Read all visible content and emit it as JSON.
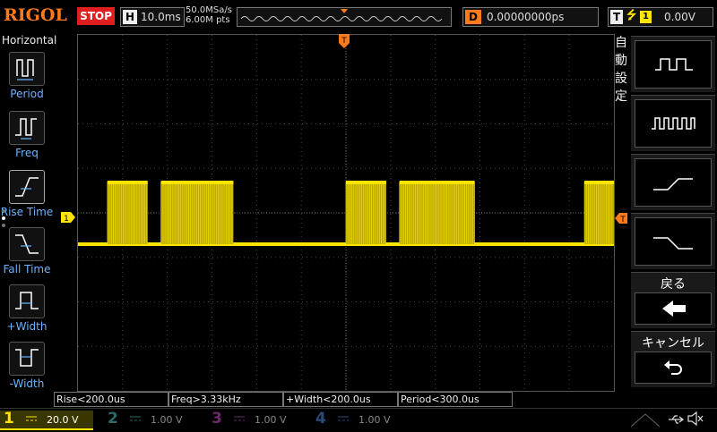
{
  "brand": "RIGOL",
  "run_state": "STOP",
  "horizontal": {
    "key": "H",
    "timebase": "10.0ms",
    "sample_rate": "50.0MSa/s",
    "memory_depth": "6.00M pts"
  },
  "delay": {
    "key": "D",
    "value": "0.00000000ps"
  },
  "trigger": {
    "key": "T",
    "edge_symbol": "⭍",
    "source": "1",
    "level": "0.00V"
  },
  "trigger_marker": "T",
  "channel_marker": "1",
  "left_menu": {
    "title": "Horizontal",
    "items": [
      {
        "label": "Period",
        "icon": "period-icon"
      },
      {
        "label": "Freq",
        "icon": "frequency-icon"
      },
      {
        "label": "Rise Time",
        "icon": "rise-time-icon"
      },
      {
        "label": "Fall Time",
        "icon": "fall-time-icon"
      },
      {
        "label": "+Width",
        "icon": "positive-width-icon"
      },
      {
        "label": "-Width",
        "icon": "negative-width-icon"
      }
    ]
  },
  "right_menu": {
    "title": "自動設定",
    "items": [
      {
        "icon": "square-wave-slow-icon"
      },
      {
        "icon": "square-wave-fast-icon"
      },
      {
        "icon": "rising-edge-icon"
      },
      {
        "icon": "falling-edge-icon"
      }
    ],
    "back_label": "戻る",
    "cancel_label": "キャンセル"
  },
  "measurements": [
    "Rise<200.0us",
    "Freq>3.33kHz",
    "+Width<200.0us",
    "Period<300.0us"
  ],
  "channels": [
    {
      "num": "1",
      "scale": "20.0 V",
      "color": "#ffe400",
      "active": true
    },
    {
      "num": "2",
      "scale": "1.00 V",
      "color": "#00c0c0",
      "active": false
    },
    {
      "num": "3",
      "scale": "1.00 V",
      "color": "#d040d0",
      "active": false
    },
    {
      "num": "4",
      "scale": "1.00 V",
      "color": "#3070e0",
      "active": false
    }
  ],
  "colors": {
    "accent": "#ff7a1a",
    "stop": "#e02020",
    "trace": "#ffe400",
    "menu_label": "#6cb4ff"
  },
  "trace_bursts": [
    [
      0.055,
      0.13
    ],
    [
      0.155,
      0.29
    ],
    [
      0.5,
      0.575
    ],
    [
      0.6,
      0.74
    ],
    [
      0.945,
      1.0
    ]
  ]
}
